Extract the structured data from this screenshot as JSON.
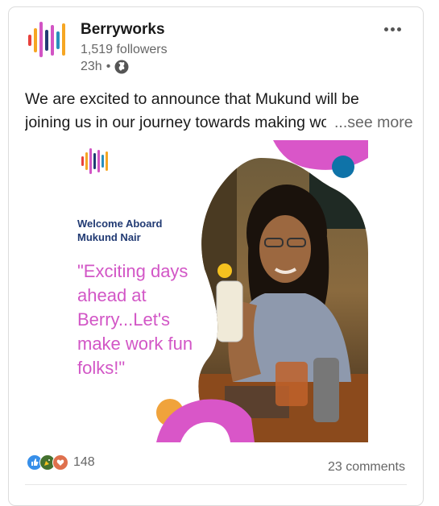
{
  "post": {
    "author": "Berryworks",
    "followers": "1,519 followers",
    "time": "23h",
    "separator": "•",
    "visibility_icon": "globe-icon",
    "menu_icon": "more-horizontal-icon",
    "text_line1": "We are excited to announce that Mukund will be",
    "text_line2": "joining us in our journey towards making work",
    "see_more": "...see more",
    "image": {
      "welcome": "Welcome Aboard\nMukund Nair",
      "quote": "\"Exciting days ahead at Berry...Let's make work fun folks!\"",
      "photo_description_icon": "person-photo"
    },
    "reactions": {
      "icons": [
        "like-icon",
        "celebrate-icon",
        "love-icon"
      ],
      "count": "148"
    },
    "comments": "23 comments"
  },
  "colors": {
    "brand_bars": [
      "#e8413c",
      "#f6a623",
      "#d254c4",
      "#213a73",
      "#2a8fbd",
      "#d254c4",
      "#f6a623"
    ],
    "magenta": "#d956c8",
    "orange": "#f0a33c",
    "teal": "#0f73a8",
    "navy": "#213a73",
    "muted_text": "#666666"
  }
}
